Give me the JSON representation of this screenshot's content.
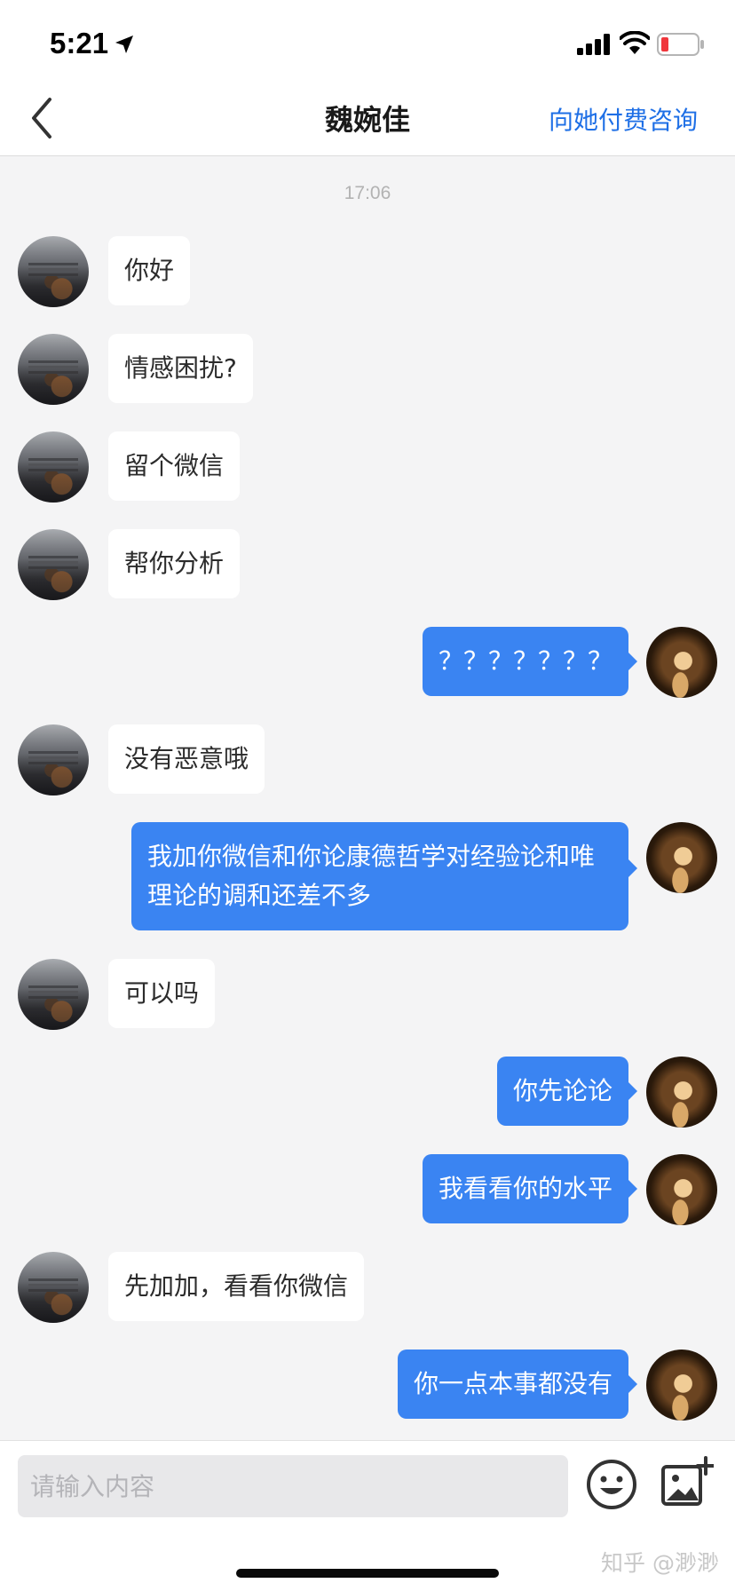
{
  "status_bar": {
    "time": "5:21"
  },
  "nav": {
    "title": "魏婉佳",
    "action_label": "向她付费咨询"
  },
  "conversation": {
    "timestamp": "17:06",
    "messages": [
      {
        "sender": "them",
        "text": "你好"
      },
      {
        "sender": "them",
        "text": "情感困扰?"
      },
      {
        "sender": "them",
        "text": "留个微信"
      },
      {
        "sender": "them",
        "text": "帮你分析"
      },
      {
        "sender": "me",
        "text": "？？？？？？？"
      },
      {
        "sender": "them",
        "text": "没有恶意哦"
      },
      {
        "sender": "me",
        "text": "我加你微信和你论康德哲学对经验论和唯理论的调和还差不多"
      },
      {
        "sender": "them",
        "text": "可以吗"
      },
      {
        "sender": "me",
        "text": "你先论论"
      },
      {
        "sender": "me",
        "text": "我看看你的水平"
      },
      {
        "sender": "them",
        "text": "先加加，看看你微信"
      },
      {
        "sender": "me",
        "text": "你一点本事都没有"
      }
    ]
  },
  "input": {
    "placeholder": "请输入内容",
    "value": ""
  },
  "icons": {
    "back": "chevron-left-icon",
    "emoji": "smiley-icon",
    "image": "add-image-icon"
  },
  "colors": {
    "accent": "#1e6fe6",
    "my_bubble": "#3a84f2",
    "their_bubble": "#ffffff",
    "background": "#f4f4f5"
  },
  "watermark": "知乎 @渺渺"
}
